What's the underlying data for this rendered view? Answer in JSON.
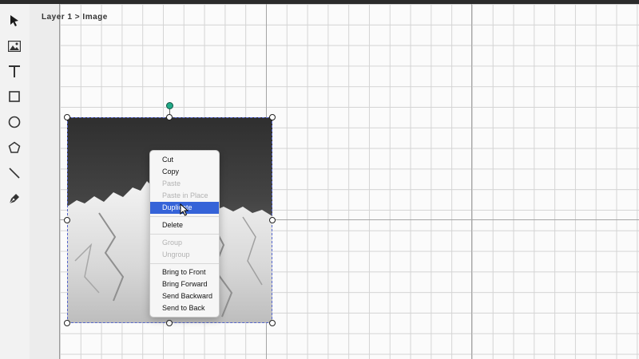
{
  "breadcrumb": "Layer 1 > Image",
  "tools": [
    {
      "name": "select-tool",
      "icon": "arrow-pointer-icon"
    },
    {
      "name": "image-tool",
      "icon": "image-icon"
    },
    {
      "name": "text-tool",
      "icon": "text-t-icon"
    },
    {
      "name": "rectangle-tool",
      "icon": "square-icon"
    },
    {
      "name": "ellipse-tool",
      "icon": "circle-icon"
    },
    {
      "name": "polygon-tool",
      "icon": "pentagon-icon"
    },
    {
      "name": "line-tool",
      "icon": "line-icon"
    },
    {
      "name": "pen-tool",
      "icon": "pen-nib-icon"
    }
  ],
  "context_menu": {
    "items": [
      {
        "label": "Cut"
      },
      {
        "label": "Copy"
      },
      {
        "label": "Paste"
      },
      {
        "label": "Paste in Place"
      },
      {
        "label": "Duplicate"
      },
      {
        "label": "Delete"
      },
      {
        "label": "Group"
      },
      {
        "label": "Ungroup"
      },
      {
        "label": "Bring to Front"
      },
      {
        "label": "Bring Forward"
      },
      {
        "label": "Send Backward"
      },
      {
        "label": "Send to Back"
      }
    ],
    "highlighted": "Duplicate",
    "disabled": [
      "Paste",
      "Paste in Place",
      "Group",
      "Ungroup"
    ]
  },
  "colors": {
    "accent": "#3563d8",
    "rotation_handle": "#22aa88",
    "selection_outline": "#5566cc"
  }
}
